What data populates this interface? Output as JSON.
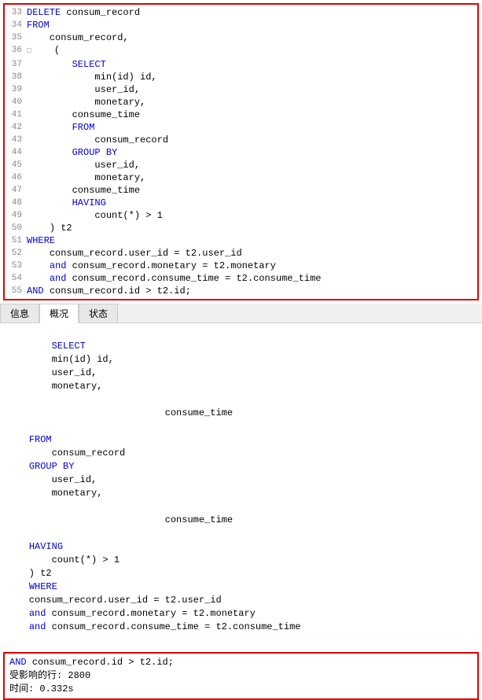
{
  "editor": {
    "lines": [
      {
        "num": "33",
        "indent": "",
        "tokens": [
          {
            "text": "DELETE ",
            "class": "kw-blue"
          },
          {
            "text": "consum_record",
            "class": ""
          }
        ]
      },
      {
        "num": "34",
        "indent": "",
        "tokens": [
          {
            "text": "FROM",
            "class": "kw-blue"
          }
        ]
      },
      {
        "num": "35",
        "indent": "    ",
        "tokens": [
          {
            "text": "consum_record,",
            "class": ""
          }
        ]
      },
      {
        "num": "36",
        "indent": "",
        "tokens": [
          {
            "text": "□",
            "class": "expand-icon"
          },
          {
            "text": "    (",
            "class": ""
          }
        ]
      },
      {
        "num": "37",
        "indent": "        ",
        "tokens": [
          {
            "text": "SELECT",
            "class": "kw-blue"
          }
        ]
      },
      {
        "num": "38",
        "indent": "            ",
        "tokens": [
          {
            "text": "min(id) id,",
            "class": ""
          }
        ]
      },
      {
        "num": "39",
        "indent": "            ",
        "tokens": [
          {
            "text": "user_id,",
            "class": ""
          }
        ]
      },
      {
        "num": "40",
        "indent": "            ",
        "tokens": [
          {
            "text": "monetary,",
            "class": ""
          }
        ]
      },
      {
        "num": "41",
        "indent": "        ",
        "tokens": [
          {
            "text": "consume_time",
            "class": ""
          }
        ]
      },
      {
        "num": "42",
        "indent": "        ",
        "tokens": [
          {
            "text": "FROM",
            "class": "kw-blue"
          }
        ]
      },
      {
        "num": "43",
        "indent": "            ",
        "tokens": [
          {
            "text": "consum_record",
            "class": ""
          }
        ]
      },
      {
        "num": "44",
        "indent": "        ",
        "tokens": [
          {
            "text": "GROUP BY",
            "class": "kw-blue"
          }
        ]
      },
      {
        "num": "45",
        "indent": "            ",
        "tokens": [
          {
            "text": "user_id,",
            "class": ""
          }
        ]
      },
      {
        "num": "46",
        "indent": "            ",
        "tokens": [
          {
            "text": "monetary,",
            "class": ""
          }
        ]
      },
      {
        "num": "47",
        "indent": "        ",
        "tokens": [
          {
            "text": "consume_time",
            "class": ""
          }
        ]
      },
      {
        "num": "48",
        "indent": "        ",
        "tokens": [
          {
            "text": "HAVING",
            "class": "kw-blue"
          }
        ]
      },
      {
        "num": "49",
        "indent": "            ",
        "tokens": [
          {
            "text": "count(*) > 1",
            "class": ""
          }
        ]
      },
      {
        "num": "50",
        "indent": "    ",
        "tokens": [
          {
            "text": ") t2",
            "class": ""
          }
        ]
      },
      {
        "num": "51",
        "indent": "",
        "tokens": [
          {
            "text": "WHERE",
            "class": "kw-blue"
          }
        ]
      },
      {
        "num": "52",
        "indent": "    ",
        "tokens": [
          {
            "text": "consum_record.user_id = t2.user_id",
            "class": ""
          }
        ]
      },
      {
        "num": "53",
        "indent": "    ",
        "tokens": [
          {
            "text": "and ",
            "class": "kw-blue"
          },
          {
            "text": "consum_record.monetary = t2.monetary",
            "class": ""
          }
        ]
      },
      {
        "num": "54",
        "indent": "    ",
        "tokens": [
          {
            "text": "and ",
            "class": "kw-blue"
          },
          {
            "text": "consum_record.consume_time = t2.consume_time",
            "class": ""
          }
        ]
      },
      {
        "num": "55",
        "indent": "",
        "tokens": [
          {
            "text": "AND ",
            "class": "kw-blue"
          },
          {
            "text": "consum_record.id > t2.id;",
            "class": ""
          }
        ]
      }
    ]
  },
  "tabs": [
    {
      "label": "信息",
      "active": false
    },
    {
      "label": "概况",
      "active": true
    },
    {
      "label": "状态",
      "active": false
    }
  ],
  "result": {
    "content": "    SELECT\n        min(id) id,\n        user_id,\n        monetary,\n\n                            consume_time\n\n    FROM\n        consum_record\n    GROUP BY\n        user_id,\n        monetary,\n\n                            consume_time\n\n    HAVING\n        count(*) > 1\n    ) t2\n    WHERE\n    consum_record.user_id = t2.user_id\n    and consum_record.monetary = t2.monetary\n    and consum_record.consume_time = t2.consume_time"
  },
  "status": {
    "line1": "AND consum_record.id > t2.id;",
    "line2": "受影响的行: 2800",
    "line3": "时间: 0.332s"
  }
}
